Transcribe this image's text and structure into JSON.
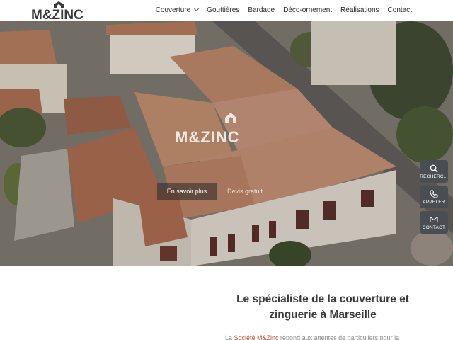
{
  "header": {
    "logo_text": "M&ZINC",
    "nav": [
      {
        "label": "Couverture",
        "has_dropdown": true
      },
      {
        "label": "Gouttières"
      },
      {
        "label": "Bardage"
      },
      {
        "label": "Déco-ornement"
      },
      {
        "label": "Réalisations"
      },
      {
        "label": "Contact"
      }
    ]
  },
  "hero": {
    "title": "M&ZINC",
    "primary_button": "En savoir plus",
    "secondary_button": "Devis gratuit"
  },
  "floating_actions": [
    {
      "label": "RECHERC...",
      "icon": "search-icon"
    },
    {
      "label": "APPELER",
      "icon": "phone-icon"
    },
    {
      "label": "CONTACT",
      "icon": "mail-icon"
    }
  ],
  "content": {
    "headline_line1": "Le spécialiste de la couverture et",
    "headline_line2": "zinguerie à Marseille",
    "intro_prefix": "La ",
    "intro_link": "Société M&Zinc",
    "intro_suffix": " répond aux attentes de particuliers pour la"
  },
  "colors": {
    "accent": "#b0533a",
    "fab_bg": "#4a4d52",
    "text": "#3a3a3a"
  }
}
